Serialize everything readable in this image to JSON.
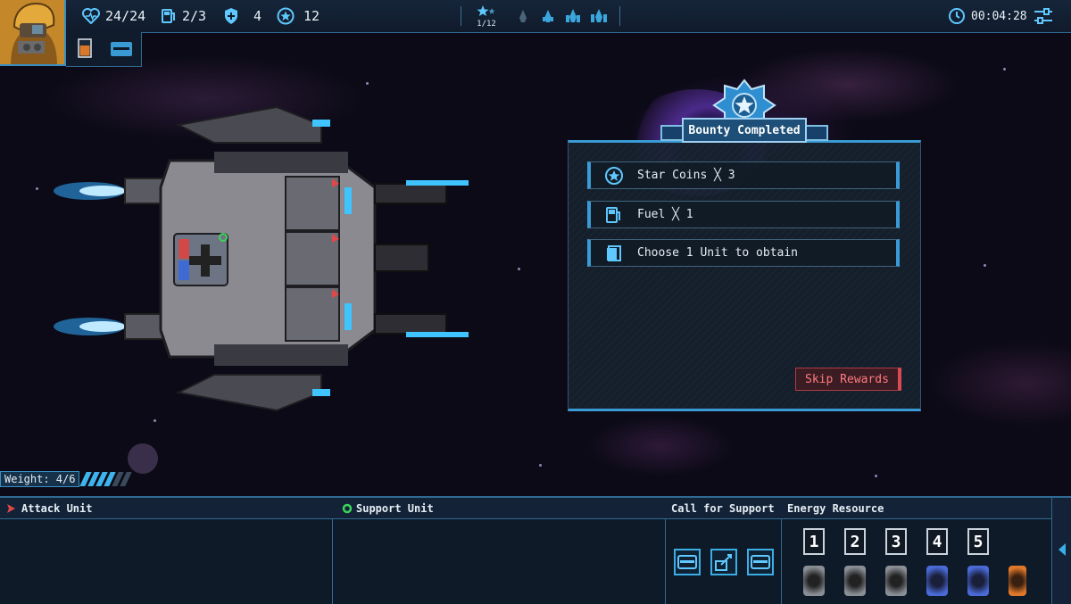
{
  "hud": {
    "health": "24/24",
    "fuel": "2/3",
    "shield": "4",
    "coins": "12",
    "sector_progress": "1/12",
    "timer": "00:04:28",
    "icons": [
      "heart-icon",
      "fuel-pump-icon",
      "shield-icon",
      "star-coin-icon",
      "sector-star-icon",
      "ship-stage-icon",
      "clock-icon",
      "settings-sliders-icon"
    ]
  },
  "reward_panel": {
    "title": "Bounty Completed",
    "rewards": [
      {
        "label": "Star Coins ╳ 3",
        "icon": "star-coin-icon"
      },
      {
        "label": "Fuel ╳ 1",
        "icon": "fuel-pump-icon"
      },
      {
        "label": "Choose 1 Unit to obtain",
        "icon": "unit-card-icon"
      }
    ],
    "skip_label": "Skip Rewards"
  },
  "weight": {
    "label": "Weight: 4/6",
    "filled": 4,
    "total": 6
  },
  "bottom": {
    "attack_unit": "Attack Unit",
    "support_unit": "Support Unit",
    "call_for_support": "Call for Support",
    "energy_resource": "Energy Resource",
    "energy_slots": [
      "1",
      "2",
      "3",
      "4",
      "5"
    ]
  },
  "colors": {
    "accent": "#3a9ad4",
    "danger": "#d94a52",
    "panel_bg": "#16222e"
  }
}
